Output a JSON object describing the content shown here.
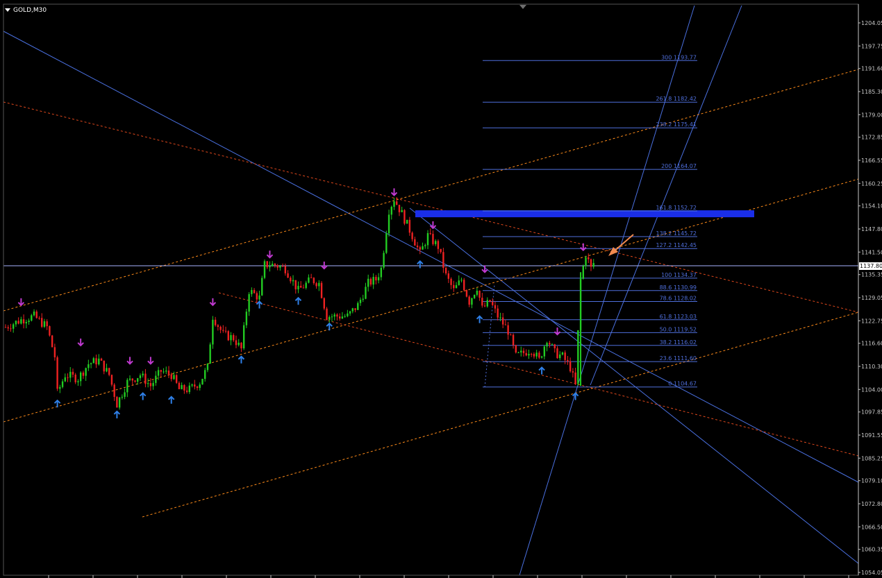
{
  "window": {
    "symbol_label": "GOLD,M30"
  },
  "colors": {
    "background": "#000000",
    "axis": "#c8c8c8",
    "axis_text": "#c8c8c8",
    "candle_up": "#22cc22",
    "candle_down": "#ee2222",
    "fib": "#4f6fdc",
    "trend_blue": "#4a70e0",
    "channel_orange": "#ff8c1a",
    "channel_red": "#e0481c",
    "zone": "#1a2ee8",
    "arrow_up": "#2f80e8",
    "arrow_down": "#c03ad0",
    "annotation_arrow": "#f08a50"
  },
  "chart_data": {
    "type": "candlestick",
    "symbol": "GOLD",
    "timeframe": "M30",
    "current_price": 1137.8,
    "current_price_label": "1137.80",
    "y_axis": {
      "range": [
        1054.0,
        1207.0
      ],
      "tick_labels": [
        "1204.05",
        "1197.75",
        "1191.60",
        "1185.30",
        "1179.00",
        "1172.85",
        "1166.55",
        "1160.25",
        "1154.10",
        "1147.80",
        "1141.50",
        "1135.35",
        "1129.05",
        "1122.75",
        "1116.60",
        "1110.30",
        "1104.00",
        "1097.85",
        "1091.55",
        "1085.25",
        "1079.10",
        "1072.80",
        "1066.50",
        "1060.35",
        "1054.05"
      ]
    },
    "fibonacci": {
      "levels": [
        {
          "ratio": "0",
          "price": 1104.67,
          "label": "0 1104.67"
        },
        {
          "ratio": "23.6",
          "price": 1111.6,
          "label": "23.6 1111.60"
        },
        {
          "ratio": "38.2",
          "price": 1116.02,
          "label": "38.2 1116.02"
        },
        {
          "ratio": "50.0",
          "price": 1119.52,
          "label": "50.0 1119.52"
        },
        {
          "ratio": "61.8",
          "price": 1123.03,
          "label": "61.8 1123.03"
        },
        {
          "ratio": "78.6",
          "price": 1128.02,
          "label": "78.6 1128.02"
        },
        {
          "ratio": "88.6",
          "price": 1130.99,
          "label": "88.6 1130.99"
        },
        {
          "ratio": "100",
          "price": 1134.37,
          "label": "100 1134.37"
        },
        {
          "ratio": "127.2",
          "price": 1142.45,
          "label": "127.2 1142.45"
        },
        {
          "ratio": "138.2",
          "price": 1145.72,
          "label": "138.2 1145.72"
        },
        {
          "ratio": "161.8",
          "price": 1152.72,
          "label": "161.8 1152.72"
        },
        {
          "ratio": "200",
          "price": 1164.07,
          "label": "200 1164.07"
        },
        {
          "ratio": "238.2",
          "price": 1175.41,
          "label": "238.2 1175.41"
        },
        {
          "ratio": "261.8",
          "price": 1182.42,
          "label": "261.8 1182.42"
        },
        {
          "ratio": "300",
          "price": 1193.77,
          "label": "300 1193.77"
        }
      ]
    },
    "resistance_zone": {
      "price_from": 1151.0,
      "price_to": 1152.9
    },
    "price_path": [
      {
        "bar": 0,
        "price": 1121
      },
      {
        "bar": 6,
        "price": 1123
      },
      {
        "bar": 11,
        "price": 1124
      },
      {
        "bar": 16,
        "price": 1121
      },
      {
        "bar": 19,
        "price": 1113
      },
      {
        "bar": 20,
        "price": 1103
      },
      {
        "bar": 23,
        "price": 1108
      },
      {
        "bar": 28,
        "price": 1107
      },
      {
        "bar": 32,
        "price": 1111
      },
      {
        "bar": 36,
        "price": 1112
      },
      {
        "bar": 40,
        "price": 1108
      },
      {
        "bar": 43,
        "price": 1100
      },
      {
        "bar": 47,
        "price": 1106
      },
      {
        "bar": 52,
        "price": 1108
      },
      {
        "bar": 56,
        "price": 1105
      },
      {
        "bar": 60,
        "price": 1109
      },
      {
        "bar": 64,
        "price": 1108
      },
      {
        "bar": 67,
        "price": 1104
      },
      {
        "bar": 71,
        "price": 1104
      },
      {
        "bar": 75,
        "price": 1106
      },
      {
        "bar": 78,
        "price": 1110
      },
      {
        "bar": 80,
        "price": 1124
      },
      {
        "bar": 84,
        "price": 1119
      },
      {
        "bar": 88,
        "price": 1118
      },
      {
        "bar": 91,
        "price": 1115
      },
      {
        "bar": 94,
        "price": 1131
      },
      {
        "bar": 98,
        "price": 1129
      },
      {
        "bar": 100,
        "price": 1138
      },
      {
        "bar": 104,
        "price": 1138
      },
      {
        "bar": 108,
        "price": 1137
      },
      {
        "bar": 113,
        "price": 1131
      },
      {
        "bar": 118,
        "price": 1134
      },
      {
        "bar": 121,
        "price": 1133
      },
      {
        "bar": 124,
        "price": 1124
      },
      {
        "bar": 128,
        "price": 1124
      },
      {
        "bar": 132,
        "price": 1124
      },
      {
        "bar": 136,
        "price": 1127
      },
      {
        "bar": 140,
        "price": 1133
      },
      {
        "bar": 143,
        "price": 1134
      },
      {
        "bar": 145,
        "price": 1137
      },
      {
        "bar": 148,
        "price": 1153
      },
      {
        "bar": 150,
        "price": 1156
      },
      {
        "bar": 153,
        "price": 1152
      },
      {
        "bar": 157,
        "price": 1146
      },
      {
        "bar": 160,
        "price": 1141
      },
      {
        "bar": 163,
        "price": 1146
      },
      {
        "bar": 167,
        "price": 1143
      },
      {
        "bar": 170,
        "price": 1135
      },
      {
        "bar": 173,
        "price": 1131
      },
      {
        "bar": 176,
        "price": 1134
      },
      {
        "bar": 179,
        "price": 1128
      },
      {
        "bar": 182,
        "price": 1132
      },
      {
        "bar": 184,
        "price": 1126
      },
      {
        "bar": 187,
        "price": 1128
      },
      {
        "bar": 190,
        "price": 1124
      },
      {
        "bar": 194,
        "price": 1120
      },
      {
        "bar": 197,
        "price": 1113
      },
      {
        "bar": 200,
        "price": 1114
      },
      {
        "bar": 203,
        "price": 1115
      },
      {
        "bar": 206,
        "price": 1112
      },
      {
        "bar": 209,
        "price": 1118
      },
      {
        "bar": 212,
        "price": 1114
      },
      {
        "bar": 215,
        "price": 1113
      },
      {
        "bar": 218,
        "price": 1110
      },
      {
        "bar": 220,
        "price": 1105
      },
      {
        "bar": 222,
        "price": 1134
      },
      {
        "bar": 224,
        "price": 1141
      },
      {
        "bar": 226,
        "price": 1137
      },
      {
        "bar": 228,
        "price": 1140
      }
    ],
    "signal_arrows": [
      {
        "bar": 6,
        "price": 1127,
        "dir": "down"
      },
      {
        "bar": 20,
        "price": 1101,
        "dir": "up"
      },
      {
        "bar": 29,
        "price": 1116,
        "dir": "down"
      },
      {
        "bar": 43,
        "price": 1098,
        "dir": "up"
      },
      {
        "bar": 48,
        "price": 1111,
        "dir": "down"
      },
      {
        "bar": 53,
        "price": 1103,
        "dir": "up"
      },
      {
        "bar": 56,
        "price": 1111,
        "dir": "down"
      },
      {
        "bar": 64,
        "price": 1102,
        "dir": "up"
      },
      {
        "bar": 80,
        "price": 1127,
        "dir": "down"
      },
      {
        "bar": 91,
        "price": 1113,
        "dir": "up"
      },
      {
        "bar": 98,
        "price": 1128,
        "dir": "up"
      },
      {
        "bar": 102,
        "price": 1140,
        "dir": "down"
      },
      {
        "bar": 113,
        "price": 1129,
        "dir": "up"
      },
      {
        "bar": 123,
        "price": 1137,
        "dir": "down"
      },
      {
        "bar": 125,
        "price": 1122,
        "dir": "up"
      },
      {
        "bar": 150,
        "price": 1157,
        "dir": "down"
      },
      {
        "bar": 160,
        "price": 1139,
        "dir": "up"
      },
      {
        "bar": 165,
        "price": 1148,
        "dir": "down"
      },
      {
        "bar": 183,
        "price": 1124,
        "dir": "up"
      },
      {
        "bar": 185,
        "price": 1136,
        "dir": "down"
      },
      {
        "bar": 207,
        "price": 1110,
        "dir": "up"
      },
      {
        "bar": 213,
        "price": 1119,
        "dir": "down"
      },
      {
        "bar": 220,
        "price": 1103,
        "dir": "up"
      },
      {
        "bar": 223,
        "price": 1142,
        "dir": "down"
      }
    ]
  }
}
